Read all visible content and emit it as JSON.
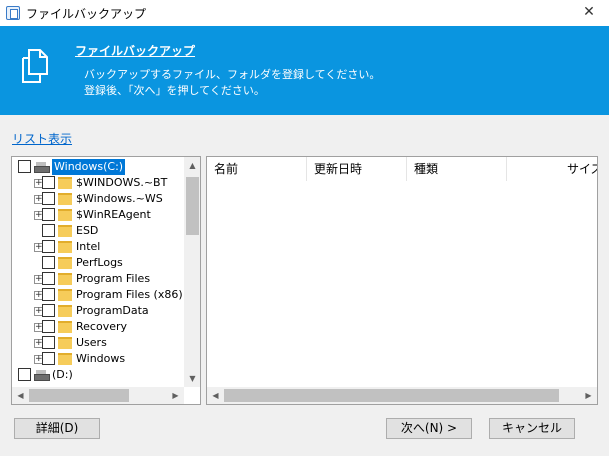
{
  "window": {
    "title": "ファイルバックアップ",
    "close_glyph": "✕"
  },
  "banner": {
    "title": "ファイルバックアップ",
    "line1": "バックアップするファイル、フォルダを登録してください。",
    "line2": "登録後、「次へ」を押してください。",
    "background": "#0a95e0"
  },
  "list_view_link": "リスト表示",
  "tree": {
    "items": [
      {
        "label": "Windows(C:)",
        "type": "drive",
        "level": 0,
        "expander": "",
        "selected": true
      },
      {
        "label": "$WINDOWS.~BT",
        "type": "folder",
        "level": 1,
        "expander": "+"
      },
      {
        "label": "$Windows.~WS",
        "type": "folder",
        "level": 1,
        "expander": "+"
      },
      {
        "label": "$WinREAgent",
        "type": "folder",
        "level": 1,
        "expander": "+"
      },
      {
        "label": "ESD",
        "type": "folder",
        "level": 1,
        "expander": ""
      },
      {
        "label": "Intel",
        "type": "folder",
        "level": 1,
        "expander": "+"
      },
      {
        "label": "PerfLogs",
        "type": "folder",
        "level": 1,
        "expander": ""
      },
      {
        "label": "Program Files",
        "type": "folder",
        "level": 1,
        "expander": "+"
      },
      {
        "label": "Program Files (x86)",
        "type": "folder",
        "level": 1,
        "expander": "+"
      },
      {
        "label": "ProgramData",
        "type": "folder",
        "level": 1,
        "expander": "+"
      },
      {
        "label": "Recovery",
        "type": "folder",
        "level": 1,
        "expander": "+"
      },
      {
        "label": "Users",
        "type": "folder",
        "level": 1,
        "expander": "+"
      },
      {
        "label": "Windows",
        "type": "folder",
        "level": 1,
        "expander": "+"
      },
      {
        "label": "(D:)",
        "type": "drive",
        "level": 0,
        "expander": ""
      }
    ]
  },
  "file_list": {
    "columns": [
      "名前",
      "更新日時",
      "種類",
      "サイズ"
    ]
  },
  "buttons": {
    "details": "詳細(D)",
    "next": "次へ(N) >",
    "cancel": "キャンセル"
  },
  "scroll_arrows": {
    "up": "▲",
    "down": "▼",
    "left": "◀",
    "right": "▶"
  }
}
